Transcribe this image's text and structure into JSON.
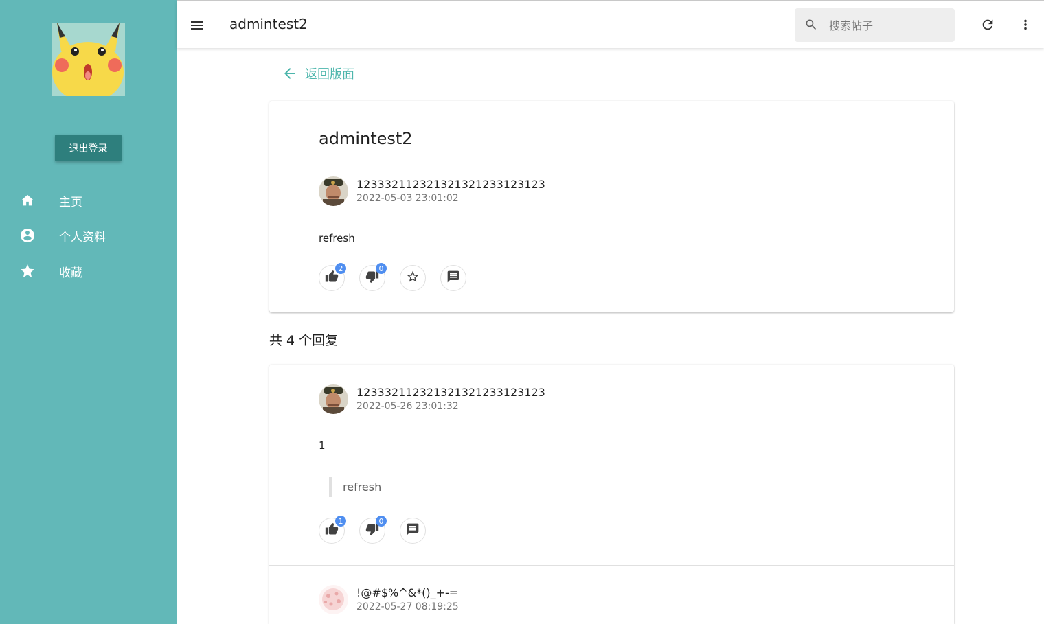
{
  "sidebar": {
    "logout_label": "退出登录",
    "items": [
      {
        "label": "主页",
        "icon": "home-icon"
      },
      {
        "label": "个人资料",
        "icon": "account-circle-icon"
      },
      {
        "label": "收藏",
        "icon": "star-icon"
      }
    ]
  },
  "header": {
    "title": "admintest2",
    "search_placeholder": "搜索帖子"
  },
  "back_label": "返回版面",
  "post": {
    "title": "admintest2",
    "author": "12333211232132132123312312‌3",
    "time": "2022-05-03 23:01:02",
    "body": "refresh",
    "likes": "2",
    "dislikes": "0"
  },
  "reply_count_label": "共 4 个回复",
  "replies": [
    {
      "author": "12333211232132132123312312‌3",
      "time": "2022-05-26 23:01:32",
      "body": "1",
      "quote": "refresh",
      "likes": "1",
      "dislikes": "0"
    },
    {
      "author": "!@#$%^&*()_+-=",
      "time": "2022-05-27 08:19:25"
    }
  ],
  "colors": {
    "sidebar": "#62b8b8",
    "logout_button": "#2e7f7d",
    "accent": "#4db6ac",
    "badge": "#4f8ef0"
  }
}
